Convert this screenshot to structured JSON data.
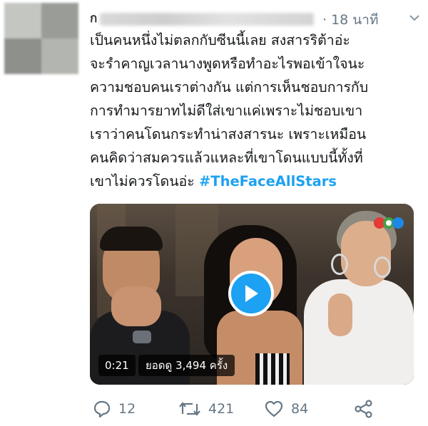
{
  "tweet": {
    "author_initial": "ก",
    "timestamp": "· 18 นาที",
    "text_lines": [
      "เป็นคนหนึ่งไม่ตลกกับซีนนี้เลย สงสารริต้าอ่ะ",
      "จะรำคาญเวลานางพูดหรือทำอะไรพอเข้าใจนะ",
      "ความชอบคนเราต่างกัน แต่การเห็นชอบการกับ",
      "การทำมารยาทไม่ดีใส่เขาแค่เพราะไม่ชอบเขา",
      "เราว่าคนโดนกระทำน่าสงสารนะ เพราะเหมือน",
      "คนคิดว่าสมควรแล้วแหละที่เขาโดนแบบนี้ทั้งที่",
      "เขาไม่ควรโดนอ่ะ "
    ],
    "hashtag": "#TheFaceAllStars"
  },
  "video": {
    "duration": "0:21",
    "views": "ยอดดู 3,494 ครั้ง",
    "channel_logo_icon": "channel-3-logo-icon",
    "play_icon": "play-icon"
  },
  "actions": {
    "reply_count": "12",
    "retweet_count": "421",
    "like_count": "84"
  },
  "colors": {
    "accent": "#1da1f2",
    "muted": "#657786",
    "text": "#14171a"
  }
}
